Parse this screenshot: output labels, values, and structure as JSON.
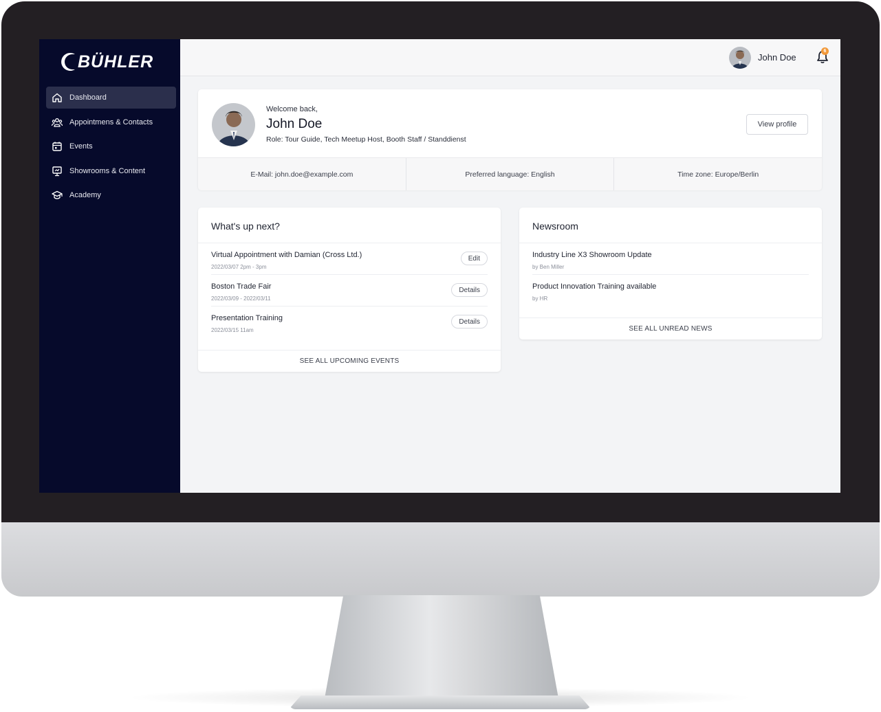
{
  "brand": {
    "name": "BÜHLER"
  },
  "sidebar": {
    "items": [
      {
        "label": "Dashboard",
        "icon": "home-icon",
        "active": true
      },
      {
        "label": "Appointmens & Contacts",
        "icon": "contacts-icon"
      },
      {
        "label": "Events",
        "icon": "calendar-icon"
      },
      {
        "label": "Showrooms & Content",
        "icon": "presentation-icon"
      },
      {
        "label": "Academy",
        "icon": "graduation-cap-icon"
      }
    ]
  },
  "header": {
    "user_name": "John Doe",
    "notification_count": "6"
  },
  "profile": {
    "welcome": "Welcome back,",
    "name": "John Doe",
    "role": "Role: Tour Guide, Tech Meetup Host, Booth Staff / Standdienst",
    "view_profile_label": "View profile",
    "email": "E-Mail: john.doe@example.com",
    "language": "Preferred language: English",
    "timezone": "Time zone: Europe/Berlin"
  },
  "upcoming": {
    "title": "What's up next?",
    "items": [
      {
        "title": "Virtual Appointment with Damian (Cross Ltd.)",
        "date": "2022/03/07 2pm - 3pm",
        "action": "Edit"
      },
      {
        "title": "Boston Trade Fair",
        "date": "2022/03/09 - 2022/03/11",
        "action": "Details"
      },
      {
        "title": "Presentation Training",
        "date": "2022/03/15 11am",
        "action": "Details"
      }
    ],
    "see_all": "SEE ALL UPCOMING EVENTS"
  },
  "news": {
    "title": "Newsroom",
    "items": [
      {
        "title": "Industry Line X3 Showroom Update",
        "author": "by Ben Miller"
      },
      {
        "title": "Product Innovation Training available",
        "author": "by HR"
      }
    ],
    "see_all": "SEE ALL UNREAD NEWS"
  },
  "colors": {
    "sidebar_bg": "#060a2b",
    "sidebar_active": "#2b2f4c",
    "content_bg": "#f3f4f6",
    "badge": "#f2993a",
    "bezel": "#231f23"
  }
}
